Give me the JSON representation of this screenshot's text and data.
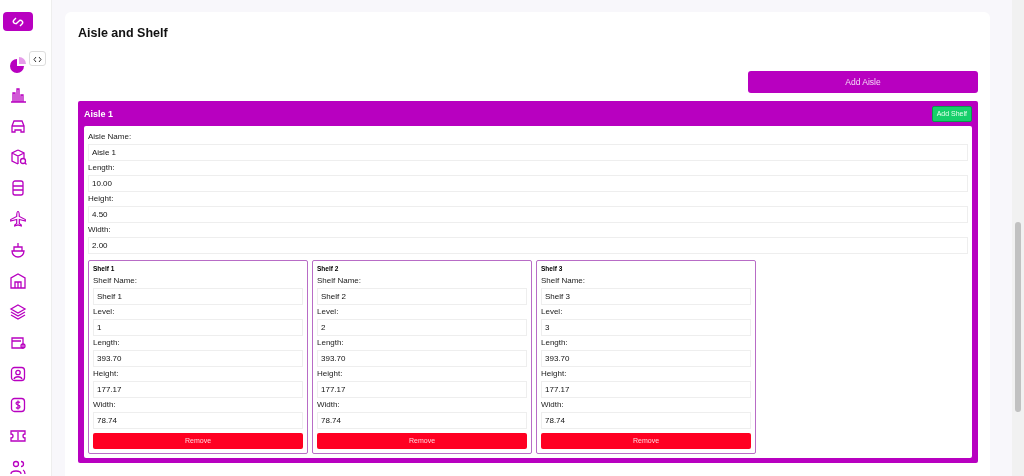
{
  "page": {
    "title": "Aisle and Shelf",
    "add_aisle_button": "Add Aisle"
  },
  "aisles": [
    {
      "title": "Aisle 1",
      "add_shelf_button": "Add Shelf",
      "fields": [
        {
          "label": "Aisle Name:",
          "value": "Aisle 1"
        },
        {
          "label": "Length:",
          "value": "10.00"
        },
        {
          "label": "Height:",
          "value": "4.50"
        },
        {
          "label": "Width:",
          "value": "2.00"
        }
      ],
      "shelves": [
        {
          "title": "Shelf 1",
          "fields": [
            {
              "label": "Shelf Name:",
              "value": "Shelf 1"
            },
            {
              "label": "Level:",
              "value": "1"
            },
            {
              "label": "Length:",
              "value": "393.70"
            },
            {
              "label": "Height:",
              "value": "177.17"
            },
            {
              "label": "Width:",
              "value": "78.74"
            }
          ],
          "remove_button": "Remove"
        },
        {
          "title": "Shelf 2",
          "fields": [
            {
              "label": "Shelf Name:",
              "value": "Shelf 2"
            },
            {
              "label": "Level:",
              "value": "2"
            },
            {
              "label": "Length:",
              "value": "393.70"
            },
            {
              "label": "Height:",
              "value": "177.17"
            },
            {
              "label": "Width:",
              "value": "78.74"
            }
          ],
          "remove_button": "Remove"
        },
        {
          "title": "Shelf 3",
          "fields": [
            {
              "label": "Shelf Name:",
              "value": "Shelf 3"
            },
            {
              "label": "Level:",
              "value": "3"
            },
            {
              "label": "Length:",
              "value": "393.70"
            },
            {
              "label": "Height:",
              "value": "177.17"
            },
            {
              "label": "Width:",
              "value": "78.74"
            }
          ],
          "remove_button": "Remove"
        }
      ]
    }
  ]
}
